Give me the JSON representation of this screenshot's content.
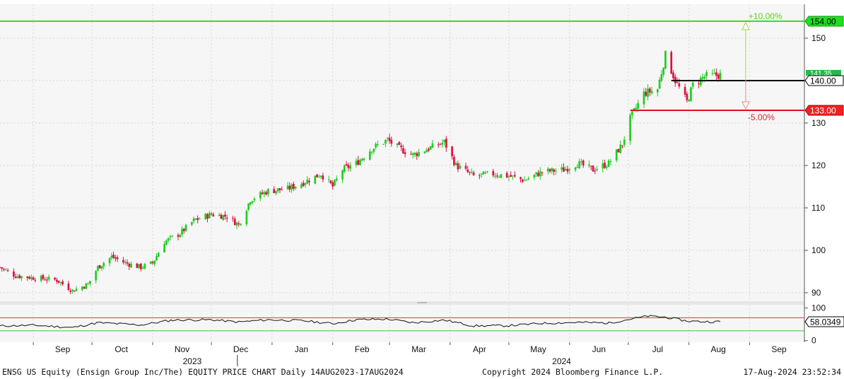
{
  "footer": {
    "left": "ENSG US Equity (Ensign Group Inc/The) EQUITY PRICE CHART  Daily 14AUG2023-17AUG2024",
    "center": "Copyright 2024 Bloomberg Finance L.P.",
    "right": "17-Aug-2024 23:52:34"
  },
  "colors": {
    "up": "#22cc22",
    "down": "#dd1144",
    "upper_line": "#33dd33",
    "lower_line": "#dd1122",
    "current_line": "#000000",
    "rsi_upper": "#dd3333",
    "rsi_lower": "#33cc33",
    "grid": "#d8d8d8"
  },
  "chart_data": {
    "type": "candlestick",
    "frequency": "Daily",
    "date_range": [
      "2023-08-14",
      "2024-08-17"
    ],
    "ylim": [
      88,
      158
    ],
    "yticks": [
      90,
      100,
      110,
      120,
      130,
      140,
      150
    ],
    "x_month_labels": [
      "Sep",
      "Oct",
      "Nov",
      "Dec",
      "Jan",
      "Feb",
      "Mar",
      "Apr",
      "May",
      "Jun",
      "Jul",
      "Aug",
      "Sep"
    ],
    "x_year_labels": [
      "2023",
      "2024"
    ],
    "price_markers": [
      {
        "label": "154.00",
        "value": 154.0,
        "role": "upper"
      },
      {
        "label": "140.00",
        "value": 140.0,
        "role": "current"
      },
      {
        "label": "133.00",
        "value": 133.0,
        "role": "lower"
      },
      {
        "label": "141.35",
        "value": 141.35,
        "role": "last"
      }
    ],
    "annotations": [
      {
        "text": "+10.00%",
        "role": "upper"
      },
      {
        "text": "-5.00%",
        "role": "lower"
      }
    ],
    "price_path": [
      [
        "2023-08-14",
        96
      ],
      [
        "2023-08-22",
        94
      ],
      [
        "2023-09-01",
        93.5
      ],
      [
        "2023-09-12",
        93
      ],
      [
        "2023-09-20",
        90.5
      ],
      [
        "2023-09-28",
        92
      ],
      [
        "2023-10-03",
        96
      ],
      [
        "2023-10-10",
        98.5
      ],
      [
        "2023-10-17",
        97
      ],
      [
        "2023-10-25",
        96
      ],
      [
        "2023-10-31",
        97
      ],
      [
        "2023-11-06",
        102
      ],
      [
        "2023-11-14",
        104
      ],
      [
        "2023-11-21",
        107
      ],
      [
        "2023-11-30",
        108.5
      ],
      [
        "2023-12-08",
        108
      ],
      [
        "2023-12-14",
        106
      ],
      [
        "2023-12-20",
        112
      ],
      [
        "2023-12-29",
        114
      ],
      [
        "2024-01-08",
        114.5
      ],
      [
        "2024-01-16",
        116
      ],
      [
        "2024-01-25",
        118
      ],
      [
        "2024-01-31",
        115
      ],
      [
        "2024-02-05",
        119
      ],
      [
        "2024-02-12",
        120.5
      ],
      [
        "2024-02-20",
        124
      ],
      [
        "2024-02-28",
        126
      ],
      [
        "2024-03-05",
        124
      ],
      [
        "2024-03-12",
        122.5
      ],
      [
        "2024-03-20",
        124
      ],
      [
        "2024-03-28",
        125.5
      ],
      [
        "2024-04-03",
        120
      ],
      [
        "2024-04-12",
        117.5
      ],
      [
        "2024-04-22",
        118
      ],
      [
        "2024-04-30",
        117.5
      ],
      [
        "2024-05-08",
        116.5
      ],
      [
        "2024-05-17",
        118.5
      ],
      [
        "2024-05-28",
        119
      ],
      [
        "2024-06-04",
        120.5
      ],
      [
        "2024-06-12",
        119
      ],
      [
        "2024-06-20",
        120.5
      ],
      [
        "2024-06-27",
        125
      ],
      [
        "2024-07-01",
        131
      ],
      [
        "2024-07-08",
        137
      ],
      [
        "2024-07-15",
        138
      ],
      [
        "2024-07-19",
        146
      ],
      [
        "2024-07-24",
        140
      ],
      [
        "2024-07-30",
        135
      ],
      [
        "2024-08-02",
        139
      ],
      [
        "2024-08-08",
        141
      ],
      [
        "2024-08-16",
        141.35
      ]
    ],
    "rsi": {
      "ylim": [
        -5,
        110
      ],
      "yticks": [
        0,
        100
      ],
      "last_label": "58.0349",
      "upper": 70,
      "lower": 30,
      "path": [
        [
          "2023-08-14",
          45
        ],
        [
          "2023-09-01",
          47
        ],
        [
          "2023-09-20",
          40
        ],
        [
          "2023-10-03",
          55
        ],
        [
          "2023-10-25",
          48
        ],
        [
          "2023-11-10",
          63
        ],
        [
          "2023-11-30",
          64
        ],
        [
          "2023-12-14",
          57
        ],
        [
          "2023-12-29",
          64
        ],
        [
          "2024-01-16",
          61
        ],
        [
          "2024-01-31",
          52
        ],
        [
          "2024-02-12",
          64
        ],
        [
          "2024-02-28",
          66
        ],
        [
          "2024-03-12",
          55
        ],
        [
          "2024-03-28",
          63
        ],
        [
          "2024-04-12",
          45
        ],
        [
          "2024-04-30",
          46
        ],
        [
          "2024-05-17",
          53
        ],
        [
          "2024-06-04",
          56
        ],
        [
          "2024-06-20",
          54
        ],
        [
          "2024-07-01",
          66
        ],
        [
          "2024-07-10",
          75
        ],
        [
          "2024-07-19",
          72
        ],
        [
          "2024-07-30",
          60
        ],
        [
          "2024-08-08",
          58
        ],
        [
          "2024-08-16",
          58
        ]
      ]
    }
  }
}
